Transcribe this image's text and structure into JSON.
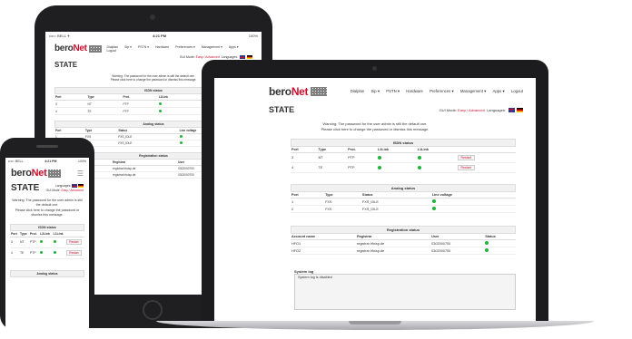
{
  "app": {
    "logo_main": "bero",
    "logo_accent": "Net",
    "page_title": "STATE",
    "warning_line1": "Warning: The password for the user admin is still the default one.",
    "warning_line2": "Please click here to change the password or dismiss this message.",
    "gui_mode_label": "GUI Mode:",
    "gui_mode_value": "Easy / Advanced",
    "languages_label": "Languages:"
  },
  "nav": [
    "Dialplan",
    "Sip ▾",
    "PSTN ▾",
    "Hardware",
    "Preferences ▾",
    "Management ▾",
    "Apps ▾",
    "Logout"
  ],
  "isdn": {
    "title": "ISDN status",
    "headers": [
      "Port",
      "Type",
      "Prot.",
      "L2Link",
      "L1Link",
      ""
    ],
    "rows": [
      {
        "port": "3",
        "type": "NT",
        "prot": "PTP",
        "action": "Restart"
      },
      {
        "port": "4",
        "type": "TE",
        "prot": "PTP",
        "action": "Restart"
      }
    ]
  },
  "analog": {
    "title": "Analog status",
    "headers": [
      "Port",
      "Type",
      "Status",
      "Line voltage"
    ],
    "rows": [
      {
        "port": "1",
        "type": "FXS",
        "status": "FXS_IDLE"
      },
      {
        "port": "2",
        "type": "FXS",
        "status": "FXS_IDLE"
      }
    ]
  },
  "registration": {
    "title": "Registration status",
    "headers": [
      "Account name",
      "Registrar",
      "User",
      "Status"
    ],
    "rows": [
      {
        "account": "HFO1",
        "registrar": "registrar.hfoisp.de",
        "user": "0302000700"
      },
      {
        "account": "HFO2",
        "registrar": "registrar.hfoisp.de",
        "user": "0302000700"
      }
    ]
  },
  "syslog": {
    "title": "System log",
    "message": "System log is disabled"
  },
  "tablet_status": {
    "carrier": "••••○ BELL ✈",
    "time": "4:21 PM",
    "battery": "100%"
  },
  "phone_status": {
    "carrier": "••••○ BELL",
    "time": "4:21 PM",
    "battery": "100%"
  },
  "colors": {
    "brand_red": "#c8102e",
    "ok_green": "#22b33a",
    "bezel": "#1f1f21"
  }
}
